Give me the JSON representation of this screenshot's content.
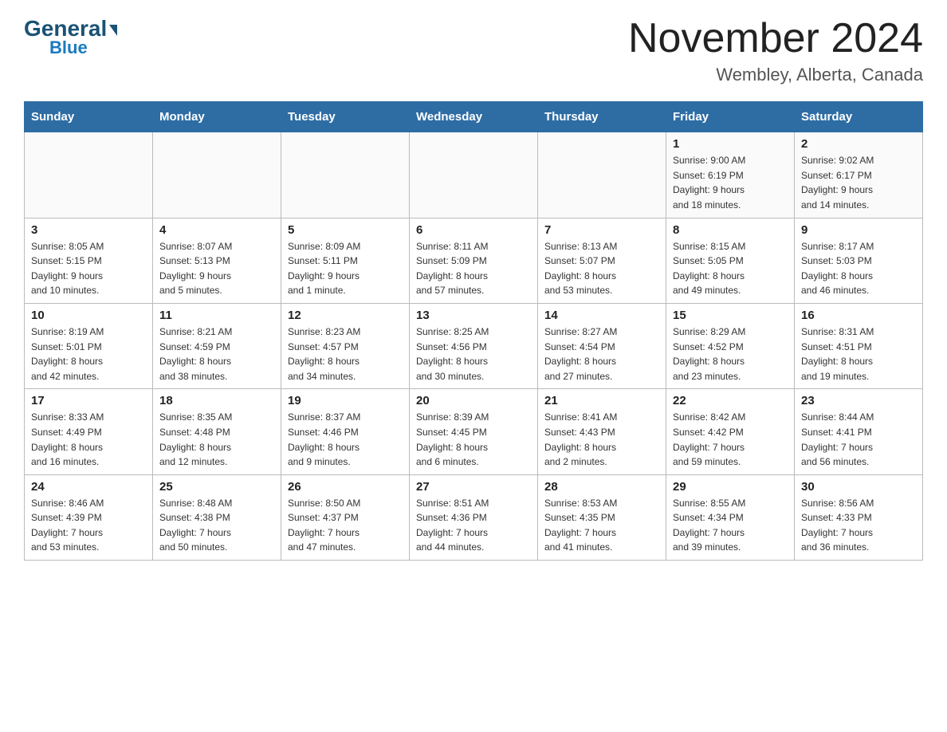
{
  "header": {
    "logo_general": "General",
    "logo_blue": "Blue",
    "month_title": "November 2024",
    "location": "Wembley, Alberta, Canada"
  },
  "weekdays": [
    "Sunday",
    "Monday",
    "Tuesday",
    "Wednesday",
    "Thursday",
    "Friday",
    "Saturday"
  ],
  "weeks": [
    [
      {
        "day": "",
        "info": ""
      },
      {
        "day": "",
        "info": ""
      },
      {
        "day": "",
        "info": ""
      },
      {
        "day": "",
        "info": ""
      },
      {
        "day": "",
        "info": ""
      },
      {
        "day": "1",
        "info": "Sunrise: 9:00 AM\nSunset: 6:19 PM\nDaylight: 9 hours\nand 18 minutes."
      },
      {
        "day": "2",
        "info": "Sunrise: 9:02 AM\nSunset: 6:17 PM\nDaylight: 9 hours\nand 14 minutes."
      }
    ],
    [
      {
        "day": "3",
        "info": "Sunrise: 8:05 AM\nSunset: 5:15 PM\nDaylight: 9 hours\nand 10 minutes."
      },
      {
        "day": "4",
        "info": "Sunrise: 8:07 AM\nSunset: 5:13 PM\nDaylight: 9 hours\nand 5 minutes."
      },
      {
        "day": "5",
        "info": "Sunrise: 8:09 AM\nSunset: 5:11 PM\nDaylight: 9 hours\nand 1 minute."
      },
      {
        "day": "6",
        "info": "Sunrise: 8:11 AM\nSunset: 5:09 PM\nDaylight: 8 hours\nand 57 minutes."
      },
      {
        "day": "7",
        "info": "Sunrise: 8:13 AM\nSunset: 5:07 PM\nDaylight: 8 hours\nand 53 minutes."
      },
      {
        "day": "8",
        "info": "Sunrise: 8:15 AM\nSunset: 5:05 PM\nDaylight: 8 hours\nand 49 minutes."
      },
      {
        "day": "9",
        "info": "Sunrise: 8:17 AM\nSunset: 5:03 PM\nDaylight: 8 hours\nand 46 minutes."
      }
    ],
    [
      {
        "day": "10",
        "info": "Sunrise: 8:19 AM\nSunset: 5:01 PM\nDaylight: 8 hours\nand 42 minutes."
      },
      {
        "day": "11",
        "info": "Sunrise: 8:21 AM\nSunset: 4:59 PM\nDaylight: 8 hours\nand 38 minutes."
      },
      {
        "day": "12",
        "info": "Sunrise: 8:23 AM\nSunset: 4:57 PM\nDaylight: 8 hours\nand 34 minutes."
      },
      {
        "day": "13",
        "info": "Sunrise: 8:25 AM\nSunset: 4:56 PM\nDaylight: 8 hours\nand 30 minutes."
      },
      {
        "day": "14",
        "info": "Sunrise: 8:27 AM\nSunset: 4:54 PM\nDaylight: 8 hours\nand 27 minutes."
      },
      {
        "day": "15",
        "info": "Sunrise: 8:29 AM\nSunset: 4:52 PM\nDaylight: 8 hours\nand 23 minutes."
      },
      {
        "day": "16",
        "info": "Sunrise: 8:31 AM\nSunset: 4:51 PM\nDaylight: 8 hours\nand 19 minutes."
      }
    ],
    [
      {
        "day": "17",
        "info": "Sunrise: 8:33 AM\nSunset: 4:49 PM\nDaylight: 8 hours\nand 16 minutes."
      },
      {
        "day": "18",
        "info": "Sunrise: 8:35 AM\nSunset: 4:48 PM\nDaylight: 8 hours\nand 12 minutes."
      },
      {
        "day": "19",
        "info": "Sunrise: 8:37 AM\nSunset: 4:46 PM\nDaylight: 8 hours\nand 9 minutes."
      },
      {
        "day": "20",
        "info": "Sunrise: 8:39 AM\nSunset: 4:45 PM\nDaylight: 8 hours\nand 6 minutes."
      },
      {
        "day": "21",
        "info": "Sunrise: 8:41 AM\nSunset: 4:43 PM\nDaylight: 8 hours\nand 2 minutes."
      },
      {
        "day": "22",
        "info": "Sunrise: 8:42 AM\nSunset: 4:42 PM\nDaylight: 7 hours\nand 59 minutes."
      },
      {
        "day": "23",
        "info": "Sunrise: 8:44 AM\nSunset: 4:41 PM\nDaylight: 7 hours\nand 56 minutes."
      }
    ],
    [
      {
        "day": "24",
        "info": "Sunrise: 8:46 AM\nSunset: 4:39 PM\nDaylight: 7 hours\nand 53 minutes."
      },
      {
        "day": "25",
        "info": "Sunrise: 8:48 AM\nSunset: 4:38 PM\nDaylight: 7 hours\nand 50 minutes."
      },
      {
        "day": "26",
        "info": "Sunrise: 8:50 AM\nSunset: 4:37 PM\nDaylight: 7 hours\nand 47 minutes."
      },
      {
        "day": "27",
        "info": "Sunrise: 8:51 AM\nSunset: 4:36 PM\nDaylight: 7 hours\nand 44 minutes."
      },
      {
        "day": "28",
        "info": "Sunrise: 8:53 AM\nSunset: 4:35 PM\nDaylight: 7 hours\nand 41 minutes."
      },
      {
        "day": "29",
        "info": "Sunrise: 8:55 AM\nSunset: 4:34 PM\nDaylight: 7 hours\nand 39 minutes."
      },
      {
        "day": "30",
        "info": "Sunrise: 8:56 AM\nSunset: 4:33 PM\nDaylight: 7 hours\nand 36 minutes."
      }
    ]
  ]
}
